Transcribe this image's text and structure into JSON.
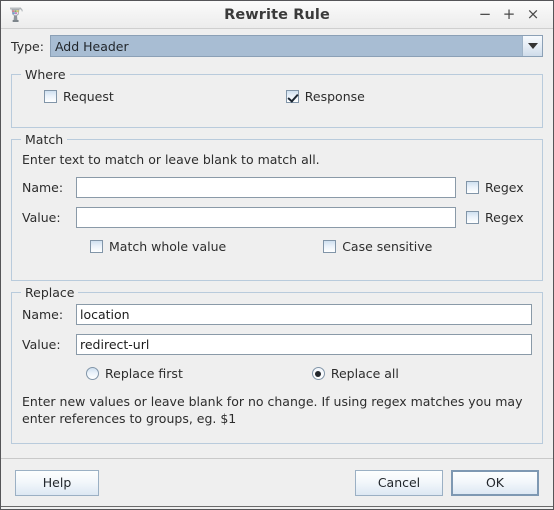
{
  "window": {
    "title": "Rewrite Rule",
    "icon": "app-jug-icon",
    "controls": {
      "minimize": "−",
      "maximize": "+",
      "close": "×"
    }
  },
  "type_row": {
    "label": "Type:",
    "selected": "Add Header",
    "arrow_icon": "chevron-down-icon"
  },
  "where": {
    "title": "Where",
    "request": {
      "label": "Request",
      "checked": false
    },
    "response": {
      "label": "Response",
      "checked": true
    }
  },
  "match": {
    "title": "Match",
    "hint": "Enter text to match or leave blank to match all.",
    "name": {
      "label": "Name:",
      "value": "",
      "placeholder": ""
    },
    "value": {
      "label": "Value:",
      "value": "",
      "placeholder": ""
    },
    "name_regex": {
      "label": "Regex",
      "checked": false
    },
    "value_regex": {
      "label": "Regex",
      "checked": false
    },
    "match_whole_value": {
      "label": "Match whole value",
      "checked": false
    },
    "case_sensitive": {
      "label": "Case sensitive",
      "checked": false
    }
  },
  "replace": {
    "title": "Replace",
    "name": {
      "label": "Name:",
      "value": "location",
      "placeholder": ""
    },
    "value": {
      "label": "Value:",
      "value": "redirect-url",
      "placeholder": ""
    },
    "replace_first": {
      "label": "Replace first",
      "selected": false
    },
    "replace_all": {
      "label": "Replace all",
      "selected": true
    },
    "hint": "Enter new values or leave blank for no change. If using regex matches you may enter references to groups, eg. $1"
  },
  "buttons": {
    "help": "Help",
    "cancel": "Cancel",
    "ok": "OK"
  },
  "colors": {
    "dialog_bg": "#efefef",
    "group_border": "#b9cbdc",
    "combo_selected_bg": "#a8bdd3",
    "text": "#2d2d2d"
  }
}
